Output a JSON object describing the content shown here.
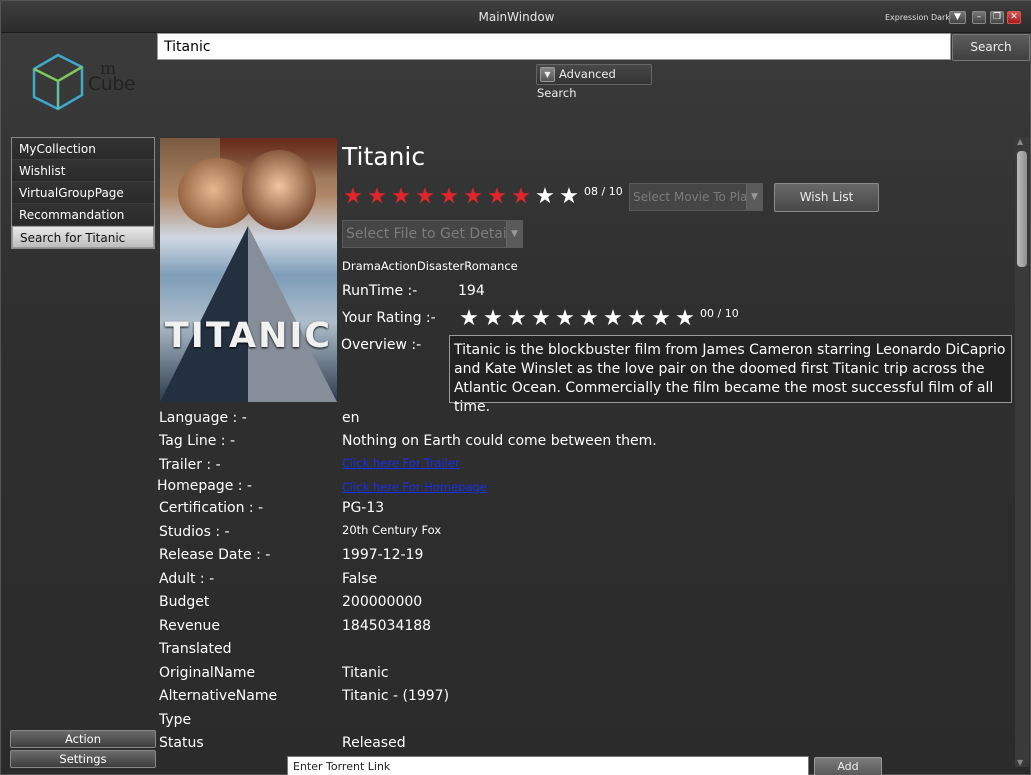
{
  "window": {
    "title": "MainWindow",
    "theme_label": "Expression Dark"
  },
  "logo": {
    "m": "m",
    "cube": "Cube"
  },
  "search": {
    "value": "Titanic",
    "button": "Search",
    "advanced": "Advanced Search"
  },
  "nav": {
    "items": [
      {
        "label": "MyCollection"
      },
      {
        "label": "Wishlist"
      },
      {
        "label": "VirtualGroupPage"
      },
      {
        "label": "Recommandation"
      },
      {
        "label": "Search for Titanic"
      }
    ],
    "selected_index": 4
  },
  "sidebar_buttons": {
    "action": "Action",
    "settings": "Settings"
  },
  "movie": {
    "poster_title": "TITANIC",
    "title": "Titanic",
    "rating_value": 8,
    "rating_max": 10,
    "rating_text": "08 / 10",
    "select_movie_placeholder": "Select Movie To Play",
    "wish_list_button": "Wish List",
    "select_file_placeholder": "Select File to Get Details",
    "genres": "DramaActionDisasterRomance",
    "runtime_label": "RunTime :-",
    "runtime": "194",
    "your_rating_label": "Your Rating :-",
    "your_rating_value": 0,
    "your_rating_text": "00 / 10",
    "overview_label": "Overview :-",
    "overview": "Titanic is the blockbuster film from James Cameron starring Leonardo DiCaprio and Kate Winslet as the love pair on the doomed first Titanic trip across the Atlantic Ocean. Commercially the film became the most successful film of all time.",
    "details": {
      "language_label": "Language : -",
      "language": "en",
      "tagline_label": "Tag Line : -",
      "tagline": "Nothing on Earth could come between them.",
      "trailer_label": "Trailer : -",
      "trailer_link": "Click here For Trailer",
      "homepage_label": "Homepage : -",
      "homepage_link": "Click here For Homepage",
      "certification_label": "Certification : -",
      "certification": "PG-13",
      "studios_label": "Studios : -",
      "studios": "20th Century Fox",
      "release_label": "Release Date : -",
      "release": "1997-12-19",
      "adult_label": "Adult : -",
      "adult": "False",
      "budget_label": "Budget",
      "budget": "200000000",
      "revenue_label": "Revenue",
      "revenue": "1845034188",
      "translated_label": "Translated",
      "originalname_label": "OriginalName",
      "originalname": "Titanic",
      "alternativename_label": "AlternativeName",
      "alternativename": "Titanic - (1997)",
      "type_label": "Type",
      "status_label": "Status",
      "status": "Released"
    }
  },
  "torrent": {
    "placeholder": "Enter Torrent Link",
    "add_button": "Add"
  },
  "colors": {
    "star_filled": "#e0242a",
    "star_empty": "#ffffff",
    "link": "#1830e6"
  }
}
